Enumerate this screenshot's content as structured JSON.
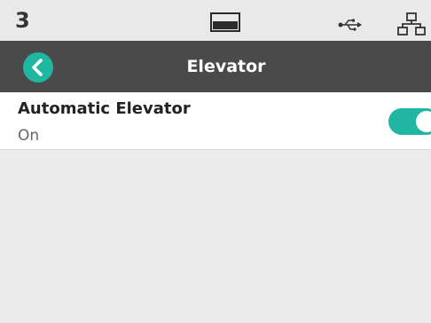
{
  "status_bar": {
    "count": "3",
    "icons": [
      "paper-tray-icon",
      "usb-icon",
      "network-icon"
    ]
  },
  "header": {
    "title": "Elevator",
    "back_icon": "chevron-left-icon"
  },
  "settings": [
    {
      "label": "Automatic Elevator",
      "value": "On",
      "toggle_on": true
    }
  ],
  "colors": {
    "accent": "#20b7a2",
    "header_background": "#4a4a4a",
    "status_bar_background": "#e9e9e9",
    "page_background": "#ececec"
  }
}
